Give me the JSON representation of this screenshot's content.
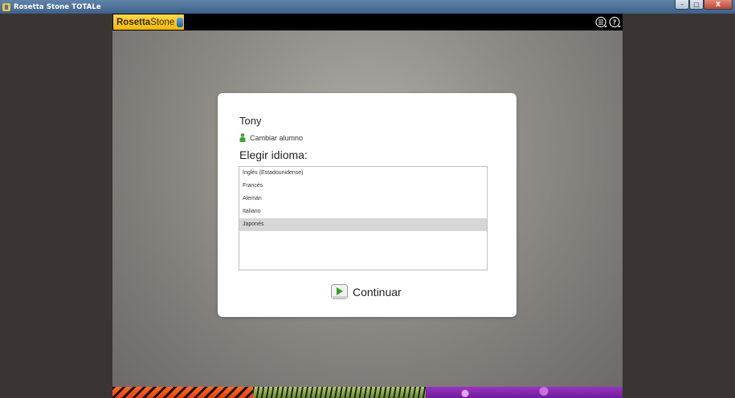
{
  "window": {
    "title": "Rosetta Stone TOTALe",
    "minimize_glyph": "–",
    "maximize_glyph": "□",
    "close_glyph": "X"
  },
  "header": {
    "logo_text_bold": "Rosetta",
    "logo_text_light": "Stone",
    "icons": [
      "menu-down-icon",
      "help-icon"
    ]
  },
  "dialog": {
    "student_name": "Tony",
    "change_student_label": "Cambiar alumno",
    "choose_language_label": "Elegir idioma:",
    "languages": [
      {
        "label": "Inglés (Estadounidense)",
        "selected": false
      },
      {
        "label": "Francés",
        "selected": false
      },
      {
        "label": "Alemán",
        "selected": false
      },
      {
        "label": "Italiano",
        "selected": false
      },
      {
        "label": "Japonés",
        "selected": true
      }
    ],
    "continue_label": "Continuar"
  },
  "colors": {
    "logo_yellow": "#f2b90c",
    "play_green": "#2fa31f",
    "selection_gray": "#d6d6d6",
    "title_bar_blue": "#4a6d94"
  }
}
